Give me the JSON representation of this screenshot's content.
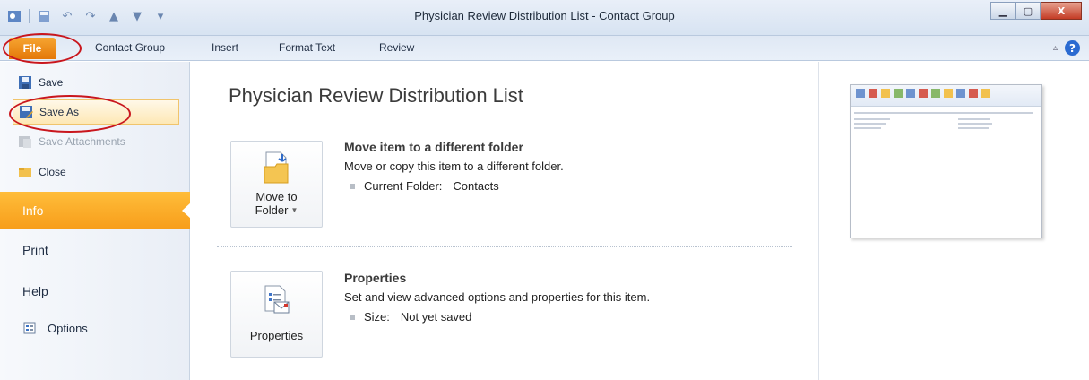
{
  "window": {
    "title": "Physician Review Distribution List  -  Contact Group"
  },
  "ribbon": {
    "tabs": [
      "File",
      "Contact Group",
      "Insert",
      "Format Text",
      "Review"
    ]
  },
  "backstage": {
    "commands": [
      {
        "label": "Save",
        "icon": "save-icon"
      },
      {
        "label": "Save As",
        "icon": "save-as-icon",
        "selected": true
      },
      {
        "label": "Save Attachments",
        "icon": "save-attachments-icon",
        "disabled": true
      },
      {
        "label": "Close",
        "icon": "close-folder-icon"
      }
    ],
    "tabs": [
      {
        "label": "Info",
        "active": true
      },
      {
        "label": "Print"
      },
      {
        "label": "Help"
      },
      {
        "label": "Options"
      }
    ]
  },
  "info": {
    "title": "Physician Review Distribution List",
    "move": {
      "button_line1": "Move to",
      "button_line2": "Folder",
      "heading": "Move item to a different folder",
      "description": "Move or copy this item to a different folder.",
      "meta_label": "Current Folder:",
      "meta_value": "Contacts"
    },
    "properties": {
      "button_label": "Properties",
      "heading": "Properties",
      "description": "Set and view advanced options and properties for this item.",
      "meta_label": "Size:",
      "meta_value": "Not yet saved"
    }
  },
  "colors": {
    "file_tab": "#e47809",
    "active_nav": "#f79d1a",
    "annotation": "#c9161d"
  }
}
